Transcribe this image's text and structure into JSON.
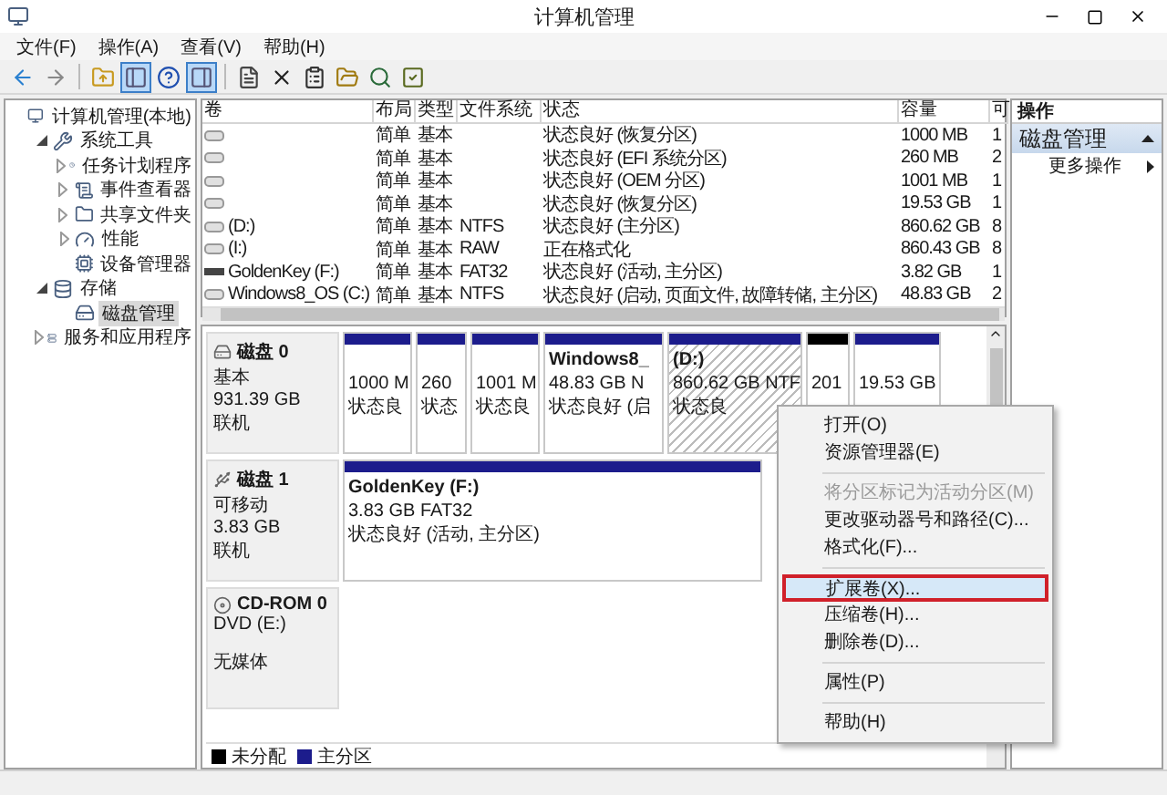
{
  "window": {
    "title": "计算机管理"
  },
  "menu": [
    "文件(F)",
    "操作(A)",
    "查看(V)",
    "帮助(H)"
  ],
  "toolbar": [
    {
      "kind": "back",
      "pressed": false
    },
    {
      "kind": "forward",
      "pressed": false
    },
    {
      "kind": "separator"
    },
    {
      "kind": "up",
      "pressed": false
    },
    {
      "kind": "tree",
      "pressed": true
    },
    {
      "kind": "help",
      "pressed": false
    },
    {
      "kind": "pane",
      "pressed": true
    },
    {
      "kind": "separator"
    },
    {
      "kind": "refresh",
      "pressed": false
    },
    {
      "kind": "delete",
      "pressed": false
    },
    {
      "kind": "properties",
      "pressed": false
    },
    {
      "kind": "open",
      "pressed": false
    },
    {
      "kind": "find",
      "pressed": false
    },
    {
      "kind": "check",
      "pressed": false
    }
  ],
  "tree": [
    {
      "label": "计算机管理(本地)",
      "kind": "computer",
      "selected": false,
      "children": [
        {
          "label": "系统工具",
          "kind": "tools",
          "expanded": true,
          "selected": false,
          "children": [
            {
              "label": "任务计划程序",
              "kind": "clock",
              "expanded": false,
              "selected": false
            },
            {
              "label": "事件查看器",
              "kind": "log",
              "expanded": false,
              "selected": false
            },
            {
              "label": "共享文件夹",
              "kind": "folder",
              "expanded": false,
              "selected": false
            },
            {
              "label": "性能",
              "kind": "gauge",
              "expanded": false,
              "selected": false
            },
            {
              "label": "设备管理器",
              "kind": "device",
              "selected": false
            }
          ]
        },
        {
          "label": "存储",
          "kind": "storage",
          "expanded": true,
          "selected": false,
          "children": [
            {
              "label": "磁盘管理",
              "kind": "disk",
              "selected": true
            }
          ]
        },
        {
          "label": "服务和应用程序",
          "kind": "services",
          "expanded": false,
          "selected": false
        }
      ]
    }
  ],
  "volumes": {
    "columns": [
      "卷",
      "布局",
      "类型",
      "文件系统",
      "状态",
      "容量",
      "可"
    ],
    "rows": [
      {
        "kind": "disk",
        "layout": "简单",
        "type": "基本",
        "status": "状态良好 (恢复分区)",
        "capacity": "1000 MB",
        "column_7": "1"
      },
      {
        "kind": "disk",
        "layout": "简单",
        "type": "基本",
        "status": "状态良好 (EFI 系统分区)",
        "capacity": "260 MB",
        "column_7": "2"
      },
      {
        "kind": "disk",
        "layout": "简单",
        "type": "基本",
        "status": "状态良好 (OEM 分区)",
        "capacity": "1001 MB",
        "column_7": "1"
      },
      {
        "kind": "disk",
        "layout": "简单",
        "type": "基本",
        "status": "状态良好 (恢复分区)",
        "capacity": "19.53 GB",
        "column_7": "1"
      },
      {
        "kind": "disk",
        "volume": "(D:)",
        "layout": "简单",
        "type": "基本",
        "filesystem": "NTFS",
        "status": "状态良好 (主分区)",
        "capacity": "860.62 GB",
        "column_7": "8"
      },
      {
        "kind": "disk",
        "volume": "(I:)",
        "layout": "简单",
        "type": "基本",
        "filesystem": "RAW",
        "status": "正在格式化",
        "capacity": "860.43 GB",
        "column_7": "8"
      },
      {
        "kind": "usb",
        "volume": "GoldenKey (F:)",
        "layout": "简单",
        "type": "基本",
        "filesystem": "FAT32",
        "status": "状态良好 (活动, 主分区)",
        "capacity": "3.82 GB",
        "column_7": "1"
      },
      {
        "kind": "disk",
        "volume": "Windows8_OS (C:)",
        "layout": "简单",
        "type": "基本",
        "filesystem": "NTFS",
        "status": "状态良好 (启动, 页面文件, 故障转储, 主分区)",
        "capacity": "48.83 GB",
        "column_7": "2"
      }
    ]
  },
  "disks": [
    {
      "kind": "disk",
      "name": "磁盘 0",
      "lines": [
        "基本",
        "931.39 GB",
        "联机"
      ],
      "partitions": [
        {
          "kind": "primary",
          "selected": false,
          "lines": [
            "1000 M",
            "状态良"
          ]
        },
        {
          "kind": "primary",
          "selected": false,
          "lines": [
            "260",
            "状态"
          ]
        },
        {
          "kind": "primary",
          "selected": false,
          "lines": [
            "1001 M",
            "状态良"
          ]
        },
        {
          "kind": "primary",
          "selected": false,
          "title": "Windows8_",
          "lines": [
            "48.83 GB N",
            "状态良好 (启"
          ]
        },
        {
          "kind": "primary",
          "selected": true,
          "title": "(D:)",
          "lines": [
            "860.62 GB NTF",
            "状态良"
          ]
        },
        {
          "kind": "unallocated",
          "selected": false,
          "lines": [
            "201"
          ]
        },
        {
          "kind": "primary",
          "selected": false,
          "lines": [
            "19.53 GB"
          ]
        }
      ]
    },
    {
      "kind": "usb",
      "name": "磁盘 1",
      "lines": [
        "可移动",
        "3.83 GB",
        "联机"
      ],
      "partitions": [
        {
          "kind": "primary",
          "selected": false,
          "title": "GoldenKey  (F:)",
          "lines": [
            "3.83 GB FAT32",
            "状态良好 (活动, 主分区)"
          ]
        }
      ]
    },
    {
      "kind": "cdrom",
      "name": "CD-ROM 0",
      "lines": [
        "DVD (E:)",
        "无媒体"
      ]
    }
  ],
  "legend": [
    {
      "label": "未分配",
      "color": "#000000"
    },
    {
      "label": "主分区",
      "color": "#1c1c8c"
    }
  ],
  "context_menu": [
    {
      "kind": "item",
      "label": "打开(O)",
      "disabled": false,
      "selected": false
    },
    {
      "kind": "item",
      "label": "资源管理器(E)",
      "disabled": false,
      "selected": false
    },
    {
      "kind": "separator"
    },
    {
      "kind": "item",
      "label": "将分区标记为活动分区(M)",
      "disabled": true,
      "selected": false
    },
    {
      "kind": "item",
      "label": "更改驱动器号和路径(C)...",
      "disabled": false,
      "selected": false
    },
    {
      "kind": "item",
      "label": "格式化(F)...",
      "disabled": false,
      "selected": false
    },
    {
      "kind": "separator"
    },
    {
      "kind": "item",
      "label": "扩展卷(X)...",
      "disabled": false,
      "selected": true
    },
    {
      "kind": "item",
      "label": "压缩卷(H)...",
      "disabled": false,
      "selected": false
    },
    {
      "kind": "item",
      "label": "删除卷(D)...",
      "disabled": false,
      "selected": false
    },
    {
      "kind": "separator"
    },
    {
      "kind": "item",
      "label": "属性(P)",
      "disabled": false,
      "selected": false
    },
    {
      "kind": "separator"
    },
    {
      "kind": "item",
      "label": "帮助(H)",
      "disabled": false,
      "selected": false
    }
  ],
  "actions": {
    "title": "操作",
    "sections": [
      {
        "label": "磁盘管理",
        "expanded": true,
        "items": [
          "更多操作"
        ]
      }
    ]
  }
}
